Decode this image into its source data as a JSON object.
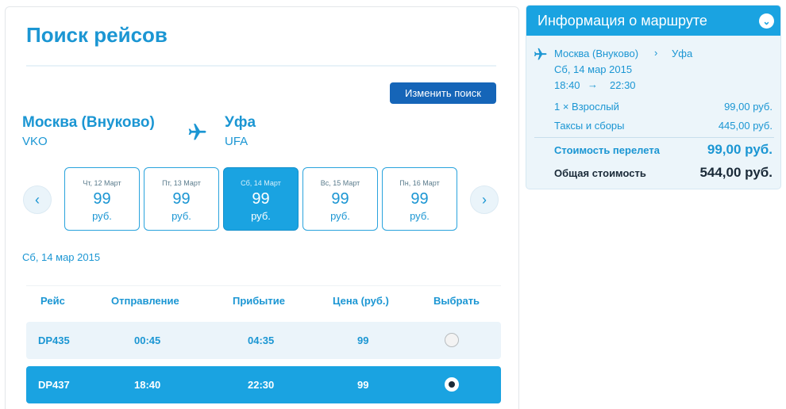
{
  "search": {
    "title": "Поиск рейсов",
    "change_button": "Изменить поиск",
    "origin_city": "Москва (Внуково)",
    "origin_code": "VKO",
    "destination_city": "Уфа",
    "destination_code": "UFA",
    "selected_date": "Сб, 14 мар 2015"
  },
  "dates": [
    {
      "label": "Чт, 12 Март",
      "price": "99",
      "currency": "руб.",
      "selected": false
    },
    {
      "label": "Пт, 13 Март",
      "price": "99",
      "currency": "руб.",
      "selected": false
    },
    {
      "label": "Сб, 14 Март",
      "price": "99",
      "currency": "руб.",
      "selected": true
    },
    {
      "label": "Вс, 15 Март",
      "price": "99",
      "currency": "руб.",
      "selected": false
    },
    {
      "label": "Пн, 16 Март",
      "price": "99",
      "currency": "руб.",
      "selected": false
    }
  ],
  "table": {
    "headers": [
      "Рейс",
      "Отправление",
      "Прибытие",
      "Цена (руб.)",
      "Выбрать"
    ],
    "rows": [
      {
        "flight": "DP435",
        "departure": "00:45",
        "arrival": "04:35",
        "price": "99",
        "selected": false
      },
      {
        "flight": "DP437",
        "departure": "18:40",
        "arrival": "22:30",
        "price": "99",
        "selected": true
      }
    ]
  },
  "route_info": {
    "title": "Информация о маршруте",
    "from": "Москва (Внуково)",
    "to": "Уфа",
    "date": "Сб, 14 мар 2015",
    "departure": "18:40",
    "arrival": "22:30",
    "passengers_label": "1 × Взрослый",
    "passengers_value": "99,00 руб.",
    "taxes_label": "Таксы и сборы",
    "taxes_value": "445,00 руб.",
    "flight_cost_label": "Стоимость перелета",
    "flight_cost_value": "99,00 руб.",
    "total_label": "Общая стоимость",
    "total_value": "544,00 руб."
  },
  "colors": {
    "accent": "#1aa3e1",
    "title_blue": "#1b96d3",
    "button": "#1565b8"
  }
}
